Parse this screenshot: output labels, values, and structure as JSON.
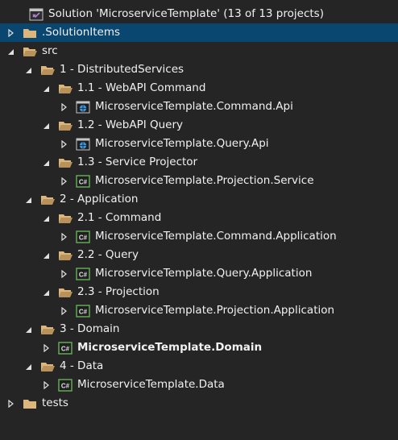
{
  "solution": {
    "label": "Solution 'MicroserviceTemplate' (13 of 13 projects)",
    "icon": "solution-icon"
  },
  "colors": {
    "background": "#252526",
    "selection": "#094771",
    "folder": "#dcb67a",
    "csharp_project": "#68b35a",
    "web_globe": "#3a96dd",
    "text": "#f1f1f1"
  },
  "nodes": [
    {
      "label": ".SolutionItems",
      "icon": "folder-icon",
      "expander": "collapsed",
      "selected": true
    },
    {
      "label": "src",
      "icon": "folder-open-icon",
      "expander": "expanded"
    },
    {
      "label": "1 - DistributedServices",
      "icon": "folder-open-icon",
      "expander": "expanded"
    },
    {
      "label": "1.1 - WebAPI Command",
      "icon": "folder-open-icon",
      "expander": "expanded"
    },
    {
      "label": "MicroserviceTemplate.Command.Api",
      "icon": "web-project-icon",
      "expander": "collapsed"
    },
    {
      "label": "1.2 - WebAPI Query",
      "icon": "folder-open-icon",
      "expander": "expanded"
    },
    {
      "label": "MicroserviceTemplate.Query.Api",
      "icon": "web-project-icon",
      "expander": "collapsed"
    },
    {
      "label": "1.3 - Service Projector",
      "icon": "folder-open-icon",
      "expander": "expanded"
    },
    {
      "label": "MicroserviceTemplate.Projection.Service",
      "icon": "csharp-project-icon",
      "expander": "collapsed"
    },
    {
      "label": "2 - Application",
      "icon": "folder-open-icon",
      "expander": "expanded"
    },
    {
      "label": "2.1 - Command",
      "icon": "folder-open-icon",
      "expander": "expanded"
    },
    {
      "label": "MicroserviceTemplate.Command.Application",
      "icon": "csharp-project-icon",
      "expander": "collapsed"
    },
    {
      "label": "2.2 - Query",
      "icon": "folder-open-icon",
      "expander": "expanded"
    },
    {
      "label": "MicroserviceTemplate.Query.Application",
      "icon": "csharp-project-icon",
      "expander": "collapsed"
    },
    {
      "label": "2.3 - Projection",
      "icon": "folder-open-icon",
      "expander": "expanded"
    },
    {
      "label": "MicroserviceTemplate.Projection.Application",
      "icon": "csharp-project-icon",
      "expander": "collapsed"
    },
    {
      "label": "3 - Domain",
      "icon": "folder-open-icon",
      "expander": "expanded"
    },
    {
      "label": "MicroserviceTemplate.Domain",
      "icon": "csharp-project-icon",
      "expander": "collapsed",
      "bold": true
    },
    {
      "label": "4 - Data",
      "icon": "folder-open-icon",
      "expander": "expanded"
    },
    {
      "label": "MicroserviceTemplate.Data",
      "icon": "csharp-project-icon",
      "expander": "collapsed"
    },
    {
      "label": "tests",
      "icon": "folder-icon",
      "expander": "collapsed"
    }
  ]
}
